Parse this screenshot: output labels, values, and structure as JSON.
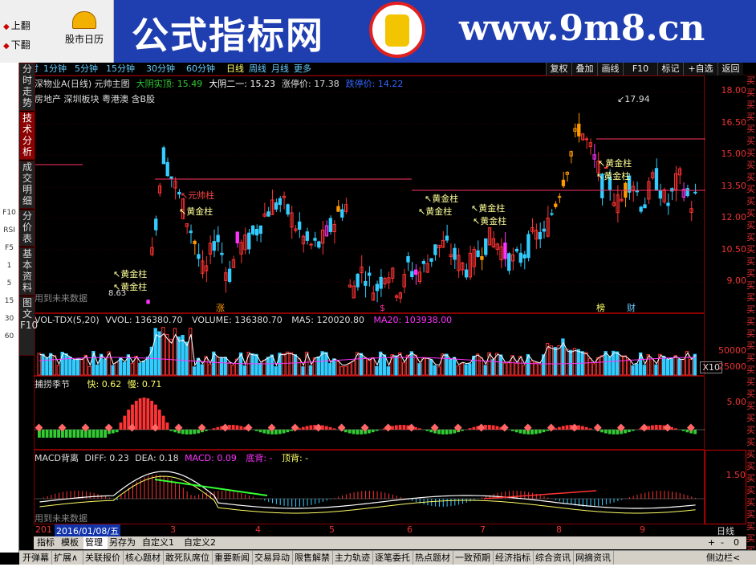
{
  "nav": {
    "page_up": "上翻",
    "page_down": "下翻",
    "calendar": "股市日历"
  },
  "brand": {
    "cn": "公式指标网",
    "url": "www.9m8.cn"
  },
  "periods": [
    "分时",
    "1分钟",
    "5分钟",
    "15分钟",
    "30分钟",
    "60分钟",
    "日线",
    "周线",
    "月线",
    "更多"
  ],
  "active_period": "日线",
  "right_buttons": [
    "复权",
    "叠加",
    "画线",
    "F10",
    "标记",
    "+自选",
    "返回"
  ],
  "side_tabs": [
    {
      "label": "分时走势",
      "active": false
    },
    {
      "label": "技术分析",
      "active": true
    },
    {
      "label": "成交明细",
      "active": false
    },
    {
      "label": "分价表",
      "active": false
    },
    {
      "label": "基本资料",
      "active": false
    },
    {
      "label": "图文F10",
      "active": false
    }
  ],
  "side_icons": [
    "F10",
    "RSI",
    "F5",
    "1",
    "5",
    "15",
    "30",
    "60"
  ],
  "main": {
    "line1": [
      {
        "text": "深物业A(日线) 元帅主图",
        "color": "#dddddd"
      },
      {
        "text": "大阴实顶: 15.49",
        "color": "#33cc33"
      },
      {
        "text": "大阴二一: 15.23",
        "color": "#ffffff"
      },
      {
        "text": "涨停价: 17.38",
        "color": "#dddddd"
      },
      {
        "text": "跌停价: 14.22",
        "color": "#3366ff"
      }
    ],
    "line2": "房地产 深圳板块 粤港澳 含B股",
    "y_labels": [
      "18.00",
      "16.50",
      "15.00",
      "13.50",
      "12.00",
      "10.50",
      "9.00"
    ],
    "price_high": "17.94",
    "price_low": "8.63",
    "future_note": "用到未来数据",
    "marker_labels": [
      "黄金柱",
      "黄金柱",
      "黄金柱",
      "元帅柱",
      "黄金柱",
      "黄金柱",
      "黄金柱",
      "黄金柱",
      "黄金柱",
      "黄金柱"
    ],
    "event_marks": [
      "涨",
      "$",
      "榜",
      "财"
    ]
  },
  "vol": {
    "title": "VOL-TDX(5,20)",
    "vvol": "VVOL: 136380.70",
    "volume": "VOLUME: 136380.70",
    "ma5": "MA5: 120020.80",
    "ma20": "MA20: 103938.00",
    "y_labels": [
      "50000",
      "25000"
    ],
    "unit": "X10"
  },
  "season": {
    "title": "捕捞季节",
    "fast": "快: 0.62",
    "slow": "慢: 0.71",
    "y_labels": [
      "5.00"
    ]
  },
  "macd": {
    "title": "MACD背离",
    "diff": "DIFF: 0.23",
    "dea": "DEA: 0.18",
    "macd": "MACD: 0.09",
    "bottom": "底背: -",
    "top": "顶背: -",
    "y_labels": [
      "1.50"
    ],
    "future_note": "用到未来数据"
  },
  "xaxis": {
    "year": "201",
    "date_cursor": "2016/01/08/五",
    "months": [
      "3",
      "4",
      "5",
      "6",
      "7",
      "8",
      "9"
    ]
  },
  "period_label": "日线",
  "zoom_buttons": [
    "+",
    "-",
    "0"
  ],
  "bottom_tabs": [
    "指标",
    "模板",
    "管理",
    "另存为",
    "自定义1",
    "自定义2"
  ],
  "active_bottom_tab": "管理",
  "shortcuts": [
    "开弹幕",
    "扩展∧",
    "关联报价",
    "核心题材",
    "敢死队席位",
    "重要新闻",
    "交易异动",
    "限售解禁",
    "主力轨迹",
    "逐笔委托",
    "热点题材",
    "一致预期",
    "经济指标",
    "综合资讯",
    "网摘资讯"
  ],
  "side_panel": "侧边栏<",
  "buy_label": "买",
  "colors": {
    "up": "#ff3333",
    "down": "#33ccff",
    "magenta": "#ff33ff",
    "orange": "#ff9900",
    "grid": "#880000"
  }
}
